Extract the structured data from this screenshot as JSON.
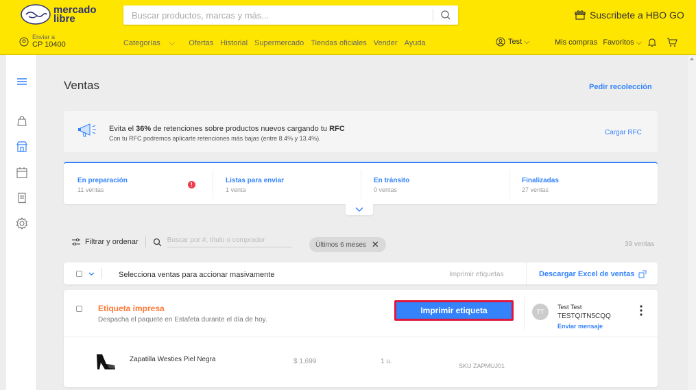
{
  "header": {
    "logo": {
      "line1": "mercado",
      "line2": "libre"
    },
    "search": {
      "placeholder": "Buscar productos, marcas y más..."
    },
    "promo": "Suscribete a HBO GO",
    "location": {
      "label": "Enviar a",
      "value": "CP 10400"
    },
    "nav": [
      "Categorías",
      "Ofertas",
      "Historial",
      "Supermercado",
      "Tiendas oficiales",
      "Vender",
      "Ayuda"
    ],
    "user": "Test",
    "my_purchases": "Mis compras",
    "favorites": "Favoritos"
  },
  "sidebar": {
    "icons": [
      "menu-icon",
      "bag-icon",
      "store-icon",
      "calendar-icon",
      "receipt-icon",
      "gear-icon"
    ]
  },
  "page": {
    "title": "Ventas",
    "pedir_recoleccion": "Pedir recolección"
  },
  "rfc_banner": {
    "title_pre": "Evita el ",
    "title_bold1": "36%",
    "title_mid": " de retenciones sobre productos nuevos cargando tu ",
    "title_bold2": "RFC",
    "subtitle": "Con tu RFC podremos aplicarte retenciones más bajas (entre 8.4% y 13.4%).",
    "link": "Cargar RFC"
  },
  "statuses": [
    {
      "label": "En preparación",
      "count": "11 ventas",
      "alert": "!"
    },
    {
      "label": "Listas para enviar",
      "count": "1 venta"
    },
    {
      "label": "En tránsito",
      "count": "0 ventas"
    },
    {
      "label": "Finalizadas",
      "count": "27 ventas"
    }
  ],
  "filters": {
    "filter_label": "Filtrar y ordenar",
    "search_placeholder": "Buscar por #, título o comprador",
    "chip": "Últimos 6 meses",
    "total": "39 ventas"
  },
  "bulk": {
    "text": "Selecciona ventas para accionar masivamente",
    "print": "Imprimir etiquetas",
    "excel": "Descargar Excel de ventas"
  },
  "order": {
    "status": "Etiqueta impresa",
    "description": "Despacha el paquete en Estafeta durante el día de hoy.",
    "button": "Imprimir etiqueta",
    "buyer": {
      "initials": "TT",
      "name": "Test Test",
      "id": "TESTQITN5CQQ",
      "message": "Enviar mensaje"
    },
    "product": {
      "name": "Zapatilla Westies Piel Negra",
      "price": "$ 1,699",
      "qty": "1 u.",
      "sku": "SKU ZAPMUJ01"
    }
  },
  "colors": {
    "brand_yellow": "#ffe600",
    "link_blue": "#3483fa",
    "status_orange": "#ff7733",
    "highlight_red": "#e0183c"
  }
}
